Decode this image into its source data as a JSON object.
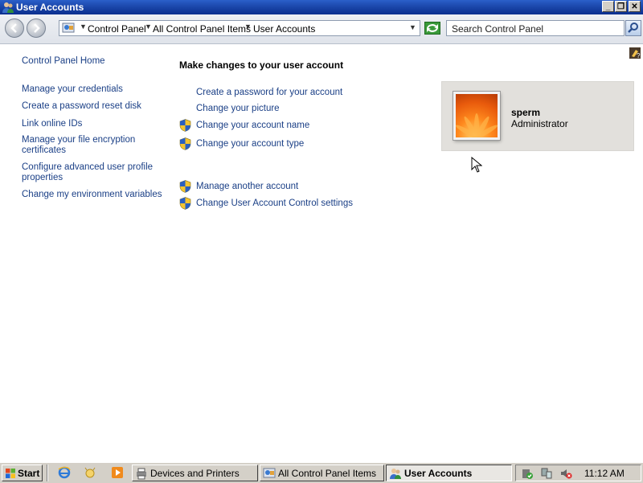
{
  "window": {
    "title": "User Accounts",
    "caption_buttons": {
      "minimize": "_",
      "maximize": "❐",
      "close": "✕"
    }
  },
  "address_bar": {
    "breadcrumbs": [
      "Control Panel",
      "All Control Panel Items",
      "User Accounts"
    ]
  },
  "search": {
    "placeholder": "Search Control Panel"
  },
  "left_nav": {
    "home": "Control Panel Home",
    "links": [
      "Manage your credentials",
      "Create a password reset disk",
      "Link online IDs",
      "Manage your file encryption certificates",
      "Configure advanced user profile properties",
      "Change my environment variables"
    ]
  },
  "main": {
    "heading": "Make changes to your user account",
    "tasks": [
      "Create a password for your account",
      "Change your picture",
      "Change your account name",
      "Change your account type"
    ],
    "other_tasks": [
      "Manage another account",
      "Change User Account Control settings"
    ]
  },
  "user_tile": {
    "name": "sperm",
    "role": "Administrator"
  },
  "taskbar": {
    "start_label": "Start",
    "buttons": [
      "Devices and Printers",
      "All Control Panel Items",
      "User Accounts"
    ],
    "clock": "11:12 AM"
  },
  "icons": {
    "shield": "uac-shield-icon",
    "help": "help-icon",
    "search": "search-icon",
    "back": "back-arrow-icon",
    "forward": "forward-arrow-icon"
  },
  "colors": {
    "link": "#1a3f86",
    "titlebar": "#1a45a8",
    "tile": "#e2e0dc"
  }
}
